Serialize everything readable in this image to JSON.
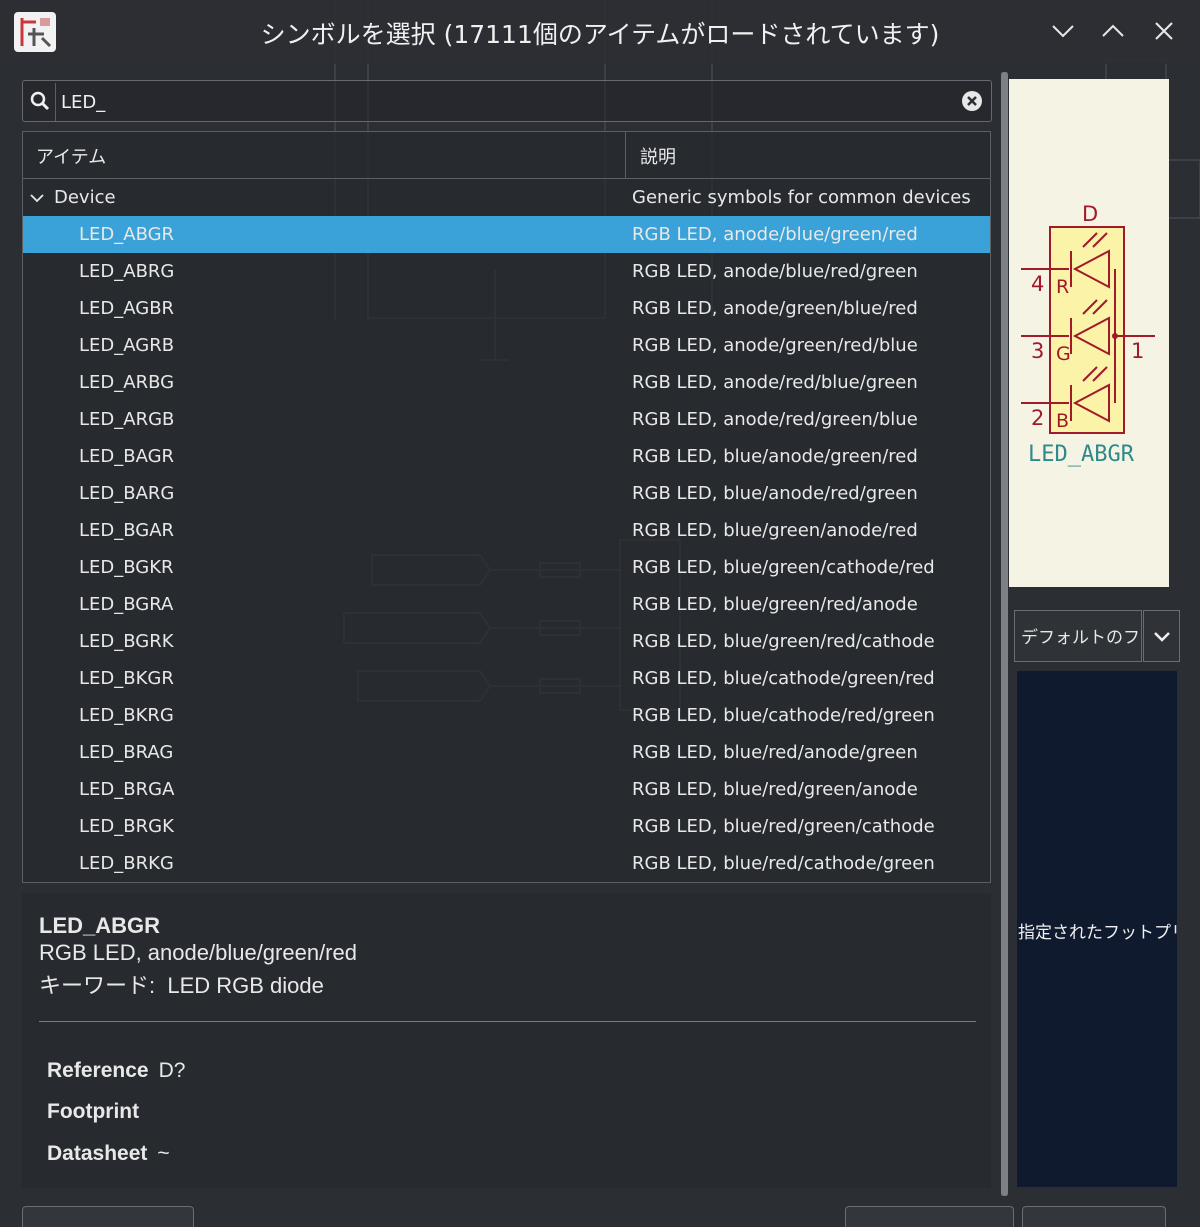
{
  "window": {
    "title": "シンボルを選択 (17111個のアイテムがロードされています)"
  },
  "search": {
    "value": "LED_"
  },
  "columns": {
    "item": "アイテム",
    "description": "説明"
  },
  "group": {
    "name": "Device",
    "description": "Generic symbols for common devices"
  },
  "rows": [
    {
      "name": "LED_ABGR",
      "desc": "RGB LED, anode/blue/green/red",
      "selected": true
    },
    {
      "name": "LED_ABRG",
      "desc": "RGB LED, anode/blue/red/green"
    },
    {
      "name": "LED_AGBR",
      "desc": "RGB LED, anode/green/blue/red"
    },
    {
      "name": "LED_AGRB",
      "desc": "RGB LED, anode/green/red/blue"
    },
    {
      "name": "LED_ARBG",
      "desc": "RGB LED, anode/red/blue/green"
    },
    {
      "name": "LED_ARGB",
      "desc": "RGB LED, anode/red/green/blue"
    },
    {
      "name": "LED_BAGR",
      "desc": "RGB LED, blue/anode/green/red"
    },
    {
      "name": "LED_BARG",
      "desc": "RGB LED, blue/anode/red/green"
    },
    {
      "name": "LED_BGAR",
      "desc": "RGB LED, blue/green/anode/red"
    },
    {
      "name": "LED_BGKR",
      "desc": "RGB LED, blue/green/cathode/red"
    },
    {
      "name": "LED_BGRA",
      "desc": "RGB LED, blue/green/red/anode"
    },
    {
      "name": "LED_BGRK",
      "desc": "RGB LED, blue/green/red/cathode"
    },
    {
      "name": "LED_BKGR",
      "desc": "RGB LED, blue/cathode/green/red"
    },
    {
      "name": "LED_BKRG",
      "desc": "RGB LED, blue/cathode/red/green"
    },
    {
      "name": "LED_BRAG",
      "desc": "RGB LED, blue/red/anode/green"
    },
    {
      "name": "LED_BRGA",
      "desc": "RGB LED, blue/red/green/anode"
    },
    {
      "name": "LED_BRGK",
      "desc": "RGB LED, blue/red/green/cathode"
    },
    {
      "name": "LED_BRKG",
      "desc": "RGB LED, blue/red/cathode/green"
    }
  ],
  "details": {
    "name": "LED_ABGR",
    "description": "RGB LED, anode/blue/green/red",
    "keywords_label": "キーワード:",
    "keywords": "LED RGB diode",
    "fields": [
      {
        "label": "Reference",
        "value": "D?"
      },
      {
        "label": "Footprint",
        "value": ""
      },
      {
        "label": "Datasheet",
        "value": "~"
      }
    ]
  },
  "preview": {
    "ref": "D",
    "value": "LED_ABGR",
    "pins": {
      "p4": "4",
      "p3": "3",
      "p2": "2",
      "p1": "1",
      "r": "R",
      "g": "G",
      "b": "B"
    },
    "symbol_color": "#a01a2a",
    "body_color": "#fbf3a8"
  },
  "footprint": {
    "selector": "デフォルトのフットプリント",
    "message": "指定されたフットプリントがありません"
  },
  "colors": {
    "selection": "#3aa2d8",
    "background": "#2b2e33",
    "footprint_bg": "#0f1a2e"
  }
}
